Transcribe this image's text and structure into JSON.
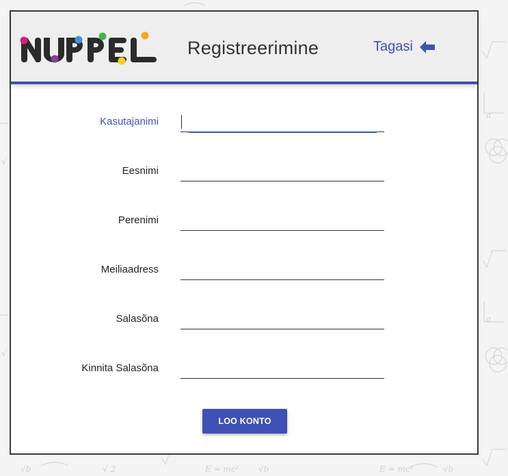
{
  "header": {
    "title": "Registreerimine",
    "back_label": "Tagasi"
  },
  "form": {
    "fields": [
      {
        "label": "Kasutajanimi",
        "value": "",
        "focused": true
      },
      {
        "label": "Eesnimi",
        "value": ""
      },
      {
        "label": "Perenimi",
        "value": ""
      },
      {
        "label": "Meiliaadress",
        "value": ""
      },
      {
        "label": "Salasõna",
        "value": ""
      },
      {
        "label": "Kinnita Salasõna",
        "value": ""
      }
    ],
    "submit_label": "LOO KONTO"
  },
  "colors": {
    "accent": "#3f51b5",
    "header_bg": "#eeeeee",
    "card_bg": "#ffffff",
    "page_bg": "#f4f4f4",
    "logo_letters": "#2b2b2b",
    "logo_dot_magenta": "#d5217f",
    "logo_dot_purple": "#8e3a9e",
    "logo_dot_blue": "#4a90d9",
    "logo_dot_green": "#45b649",
    "logo_dot_yellow": "#f6d31f",
    "logo_dot_orange": "#f5a623"
  },
  "icons": {
    "back": "arrow-left-icon"
  }
}
